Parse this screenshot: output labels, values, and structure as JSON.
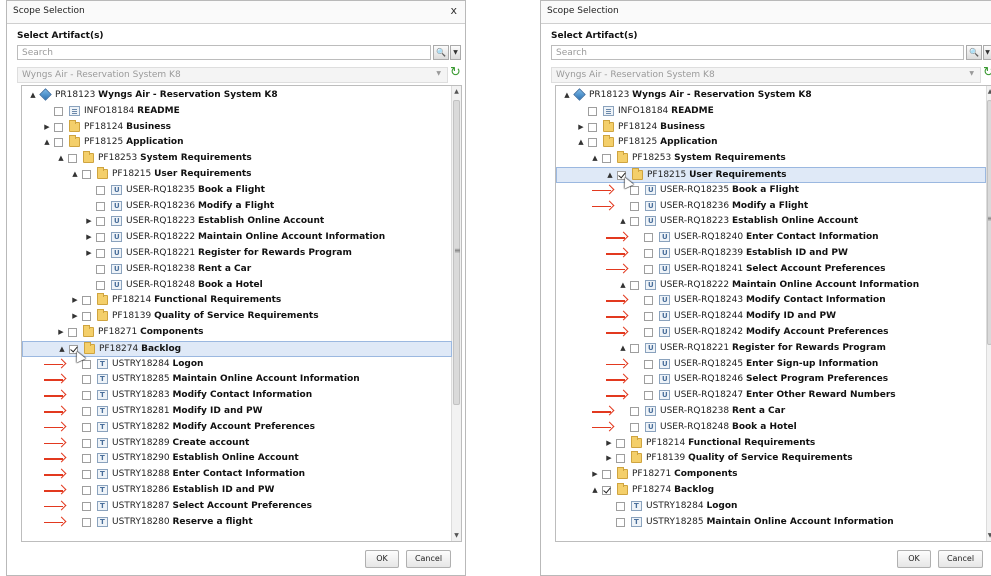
{
  "left": {
    "title": "Scope Selection",
    "close": "x",
    "artifact_label": "Select Artifact(s)",
    "search_placeholder": "Search",
    "project": "Wyngs Air - Reservation System K8",
    "ok": "OK",
    "cancel": "Cancel",
    "rows": [
      {
        "level": 0,
        "toggle": "▲",
        "icon": "cube",
        "id": "PR18123",
        "name": "Wyngs Air - Reservation System K8",
        "checkbox": false,
        "checked": false
      },
      {
        "level": 1,
        "toggle": "",
        "icon": "doc",
        "id": "INFO18184",
        "name": "README",
        "checkbox": true,
        "checked": false
      },
      {
        "level": 1,
        "toggle": "▶",
        "icon": "folder",
        "id": "PF18124",
        "name": "Business",
        "checkbox": true,
        "checked": false
      },
      {
        "level": 1,
        "toggle": "▲",
        "icon": "folder",
        "id": "PF18125",
        "name": "Application",
        "checkbox": true,
        "checked": false
      },
      {
        "level": 2,
        "toggle": "▲",
        "icon": "folder",
        "id": "PF18253",
        "name": "System Requirements",
        "checkbox": true,
        "checked": false
      },
      {
        "level": 3,
        "toggle": "▲",
        "icon": "folder",
        "id": "PF18215",
        "name": "User Requirements",
        "checkbox": true,
        "checked": false
      },
      {
        "level": 4,
        "toggle": "",
        "icon": "req",
        "id": "USER-RQ18235",
        "name": "Book a Flight",
        "checkbox": true,
        "checked": false
      },
      {
        "level": 4,
        "toggle": "",
        "icon": "req",
        "id": "USER-RQ18236",
        "name": "Modify a Flight",
        "checkbox": true,
        "checked": false
      },
      {
        "level": 4,
        "toggle": "▶",
        "icon": "req",
        "id": "USER-RQ18223",
        "name": "Establish Online Account",
        "checkbox": true,
        "checked": false
      },
      {
        "level": 4,
        "toggle": "▶",
        "icon": "req",
        "id": "USER-RQ18222",
        "name": "Maintain Online Account Information",
        "checkbox": true,
        "checked": false
      },
      {
        "level": 4,
        "toggle": "▶",
        "icon": "req",
        "id": "USER-RQ18221",
        "name": "Register for Rewards Program",
        "checkbox": true,
        "checked": false
      },
      {
        "level": 4,
        "toggle": "",
        "icon": "req",
        "id": "USER-RQ18238",
        "name": "Rent a Car",
        "checkbox": true,
        "checked": false
      },
      {
        "level": 4,
        "toggle": "",
        "icon": "req",
        "id": "USER-RQ18248",
        "name": "Book a Hotel",
        "checkbox": true,
        "checked": false
      },
      {
        "level": 3,
        "toggle": "▶",
        "icon": "folder",
        "id": "PF18214",
        "name": "Functional Requirements",
        "checkbox": true,
        "checked": false
      },
      {
        "level": 3,
        "toggle": "▶",
        "icon": "folder",
        "id": "PF18139",
        "name": "Quality of Service Requirements",
        "checkbox": true,
        "checked": false
      },
      {
        "level": 2,
        "toggle": "▶",
        "icon": "folder",
        "id": "PF18271",
        "name": "Components",
        "checkbox": true,
        "checked": false
      },
      {
        "level": 2,
        "toggle": "▲",
        "icon": "folder",
        "id": "PF18274",
        "name": "Backlog",
        "checkbox": true,
        "checked": true,
        "selected": true
      },
      {
        "level": 3,
        "toggle": "",
        "icon": "story",
        "id": "USTRY18284",
        "name": "Logon",
        "checkbox": true,
        "checked": false,
        "arrow": true
      },
      {
        "level": 3,
        "toggle": "",
        "icon": "story",
        "id": "USTRY18285",
        "name": "Maintain Online Account Information",
        "checkbox": true,
        "checked": false,
        "arrow": true
      },
      {
        "level": 3,
        "toggle": "",
        "icon": "story",
        "id": "USTRY18283",
        "name": "Modify Contact Information",
        "checkbox": true,
        "checked": false,
        "arrow": true
      },
      {
        "level": 3,
        "toggle": "",
        "icon": "story",
        "id": "USTRY18281",
        "name": "Modify ID and PW",
        "checkbox": true,
        "checked": false,
        "arrow": true
      },
      {
        "level": 3,
        "toggle": "",
        "icon": "story",
        "id": "USTRY18282",
        "name": "Modify Account Preferences",
        "checkbox": true,
        "checked": false,
        "arrow": true
      },
      {
        "level": 3,
        "toggle": "",
        "icon": "story",
        "id": "USTRY18289",
        "name": "Create account",
        "checkbox": true,
        "checked": false,
        "arrow": true
      },
      {
        "level": 3,
        "toggle": "",
        "icon": "story",
        "id": "USTRY18290",
        "name": "Establish Online Account",
        "checkbox": true,
        "checked": false,
        "arrow": true
      },
      {
        "level": 3,
        "toggle": "",
        "icon": "story",
        "id": "USTRY18288",
        "name": "Enter Contact Information",
        "checkbox": true,
        "checked": false,
        "arrow": true
      },
      {
        "level": 3,
        "toggle": "",
        "icon": "story",
        "id": "USTRY18286",
        "name": "Establish ID and PW",
        "checkbox": true,
        "checked": false,
        "arrow": true
      },
      {
        "level": 3,
        "toggle": "",
        "icon": "story",
        "id": "USTRY18287",
        "name": "Select Account Preferences",
        "checkbox": true,
        "checked": false,
        "arrow": true
      },
      {
        "level": 3,
        "toggle": "",
        "icon": "story",
        "id": "USTRY18280",
        "name": "Reserve a flight",
        "checkbox": true,
        "checked": false,
        "arrow": true
      }
    ]
  },
  "right": {
    "title": "Scope Selection",
    "artifact_label": "Select Artifact(s)",
    "search_placeholder": "Search",
    "project": "Wyngs Air - Reservation System K8",
    "ok": "OK",
    "cancel": "Cancel",
    "rows": [
      {
        "level": 0,
        "toggle": "▲",
        "icon": "cube",
        "id": "PR18123",
        "name": "Wyngs Air - Reservation System K8",
        "checkbox": false,
        "checked": false
      },
      {
        "level": 1,
        "toggle": "",
        "icon": "doc",
        "id": "INFO18184",
        "name": "README",
        "checkbox": true,
        "checked": false
      },
      {
        "level": 1,
        "toggle": "▶",
        "icon": "folder",
        "id": "PF18124",
        "name": "Business",
        "checkbox": true,
        "checked": false
      },
      {
        "level": 1,
        "toggle": "▲",
        "icon": "folder",
        "id": "PF18125",
        "name": "Application",
        "checkbox": true,
        "checked": false
      },
      {
        "level": 2,
        "toggle": "▲",
        "icon": "folder",
        "id": "PF18253",
        "name": "System Requirements",
        "checkbox": true,
        "checked": false
      },
      {
        "level": 3,
        "toggle": "▲",
        "icon": "folder",
        "id": "PF18215",
        "name": "User Requirements",
        "checkbox": true,
        "checked": true,
        "selected": true
      },
      {
        "level": 4,
        "toggle": "",
        "icon": "req",
        "id": "USER-RQ18235",
        "name": "Book a Flight",
        "checkbox": true,
        "checked": false,
        "arrow": true
      },
      {
        "level": 4,
        "toggle": "",
        "icon": "req",
        "id": "USER-RQ18236",
        "name": "Modify a Flight",
        "checkbox": true,
        "checked": false,
        "arrow": true
      },
      {
        "level": 4,
        "toggle": "▲",
        "icon": "req",
        "id": "USER-RQ18223",
        "name": "Establish Online Account",
        "checkbox": true,
        "checked": false
      },
      {
        "level": 5,
        "toggle": "",
        "icon": "req",
        "id": "USER-RQ18240",
        "name": "Enter Contact Information",
        "checkbox": true,
        "checked": false,
        "arrow": true
      },
      {
        "level": 5,
        "toggle": "",
        "icon": "req",
        "id": "USER-RQ18239",
        "name": "Establish ID and PW",
        "checkbox": true,
        "checked": false,
        "arrow": true
      },
      {
        "level": 5,
        "toggle": "",
        "icon": "req",
        "id": "USER-RQ18241",
        "name": "Select Account Preferences",
        "checkbox": true,
        "checked": false,
        "arrow": true
      },
      {
        "level": 4,
        "toggle": "▲",
        "icon": "req",
        "id": "USER-RQ18222",
        "name": "Maintain Online Account Information",
        "checkbox": true,
        "checked": false
      },
      {
        "level": 5,
        "toggle": "",
        "icon": "req",
        "id": "USER-RQ18243",
        "name": "Modify Contact Information",
        "checkbox": true,
        "checked": false,
        "arrow": true
      },
      {
        "level": 5,
        "toggle": "",
        "icon": "req",
        "id": "USER-RQ18244",
        "name": "Modify ID and PW",
        "checkbox": true,
        "checked": false,
        "arrow": true
      },
      {
        "level": 5,
        "toggle": "",
        "icon": "req",
        "id": "USER-RQ18242",
        "name": "Modify Account Preferences",
        "checkbox": true,
        "checked": false,
        "arrow": true
      },
      {
        "level": 4,
        "toggle": "▲",
        "icon": "req",
        "id": "USER-RQ18221",
        "name": "Register for Rewards Program",
        "checkbox": true,
        "checked": false
      },
      {
        "level": 5,
        "toggle": "",
        "icon": "req",
        "id": "USER-RQ18245",
        "name": "Enter Sign-up Information",
        "checkbox": true,
        "checked": false,
        "arrow": true
      },
      {
        "level": 5,
        "toggle": "",
        "icon": "req",
        "id": "USER-RQ18246",
        "name": "Select Program Preferences",
        "checkbox": true,
        "checked": false,
        "arrow": true
      },
      {
        "level": 5,
        "toggle": "",
        "icon": "req",
        "id": "USER-RQ18247",
        "name": "Enter Other Reward Numbers",
        "checkbox": true,
        "checked": false,
        "arrow": true
      },
      {
        "level": 4,
        "toggle": "",
        "icon": "req",
        "id": "USER-RQ18238",
        "name": "Rent a Car",
        "checkbox": true,
        "checked": false,
        "arrow": true
      },
      {
        "level": 4,
        "toggle": "",
        "icon": "req",
        "id": "USER-RQ18248",
        "name": "Book a Hotel",
        "checkbox": true,
        "checked": false,
        "arrow": true
      },
      {
        "level": 3,
        "toggle": "▶",
        "icon": "folder",
        "id": "PF18214",
        "name": "Functional Requirements",
        "checkbox": true,
        "checked": false
      },
      {
        "level": 3,
        "toggle": "▶",
        "icon": "folder",
        "id": "PF18139",
        "name": "Quality of Service Requirements",
        "checkbox": true,
        "checked": false
      },
      {
        "level": 2,
        "toggle": "▶",
        "icon": "folder",
        "id": "PF18271",
        "name": "Components",
        "checkbox": true,
        "checked": false
      },
      {
        "level": 2,
        "toggle": "▲",
        "icon": "folder",
        "id": "PF18274",
        "name": "Backlog",
        "checkbox": true,
        "checked": true
      },
      {
        "level": 3,
        "toggle": "",
        "icon": "story",
        "id": "USTRY18284",
        "name": "Logon",
        "checkbox": true,
        "checked": false
      },
      {
        "level": 3,
        "toggle": "",
        "icon": "story",
        "id": "USTRY18285",
        "name": "Maintain Online Account Information",
        "checkbox": true,
        "checked": false
      }
    ]
  },
  "colors": {
    "arrow": "#e2391f",
    "selection": "#dfe9f7",
    "folder": "#f4cf6a",
    "refresh": "#3a9a32"
  }
}
